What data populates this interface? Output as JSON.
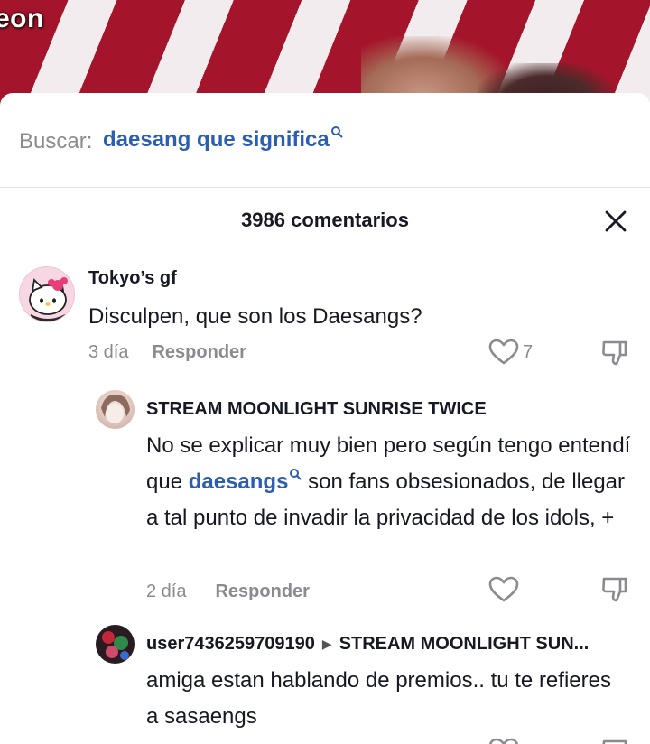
{
  "video": {
    "overlay_text": "eon"
  },
  "search": {
    "prefix": "Buscar:",
    "term": "daesang que significa"
  },
  "header": {
    "title": "3986 comentarios"
  },
  "comments": [
    {
      "username": "Tokyo’s gf",
      "text": "Disculpen, que son los Daesangs?",
      "time": "3 día",
      "reply_label": "Responder",
      "likes": "7"
    },
    {
      "username": "STREAM MOONLIGHT SUNRISE TWICE",
      "text_before": "No se explicar muy bien pero según tengo entendí que ",
      "text_link": "daesangs",
      "text_after": " son fans obsesionados, de llegar a tal punto de invadir la privacidad de los idols, +",
      "time": "2 día",
      "reply_label": "Responder"
    },
    {
      "username": "user7436259709190",
      "reply_to": "STREAM MOONLIGHT SUN...",
      "text": "amiga estan hablando de premios.. tu te refieres a sasaengs"
    }
  ],
  "colors": {
    "link": "#2b5db3",
    "muted": "#8a8b91",
    "text": "#161823"
  }
}
